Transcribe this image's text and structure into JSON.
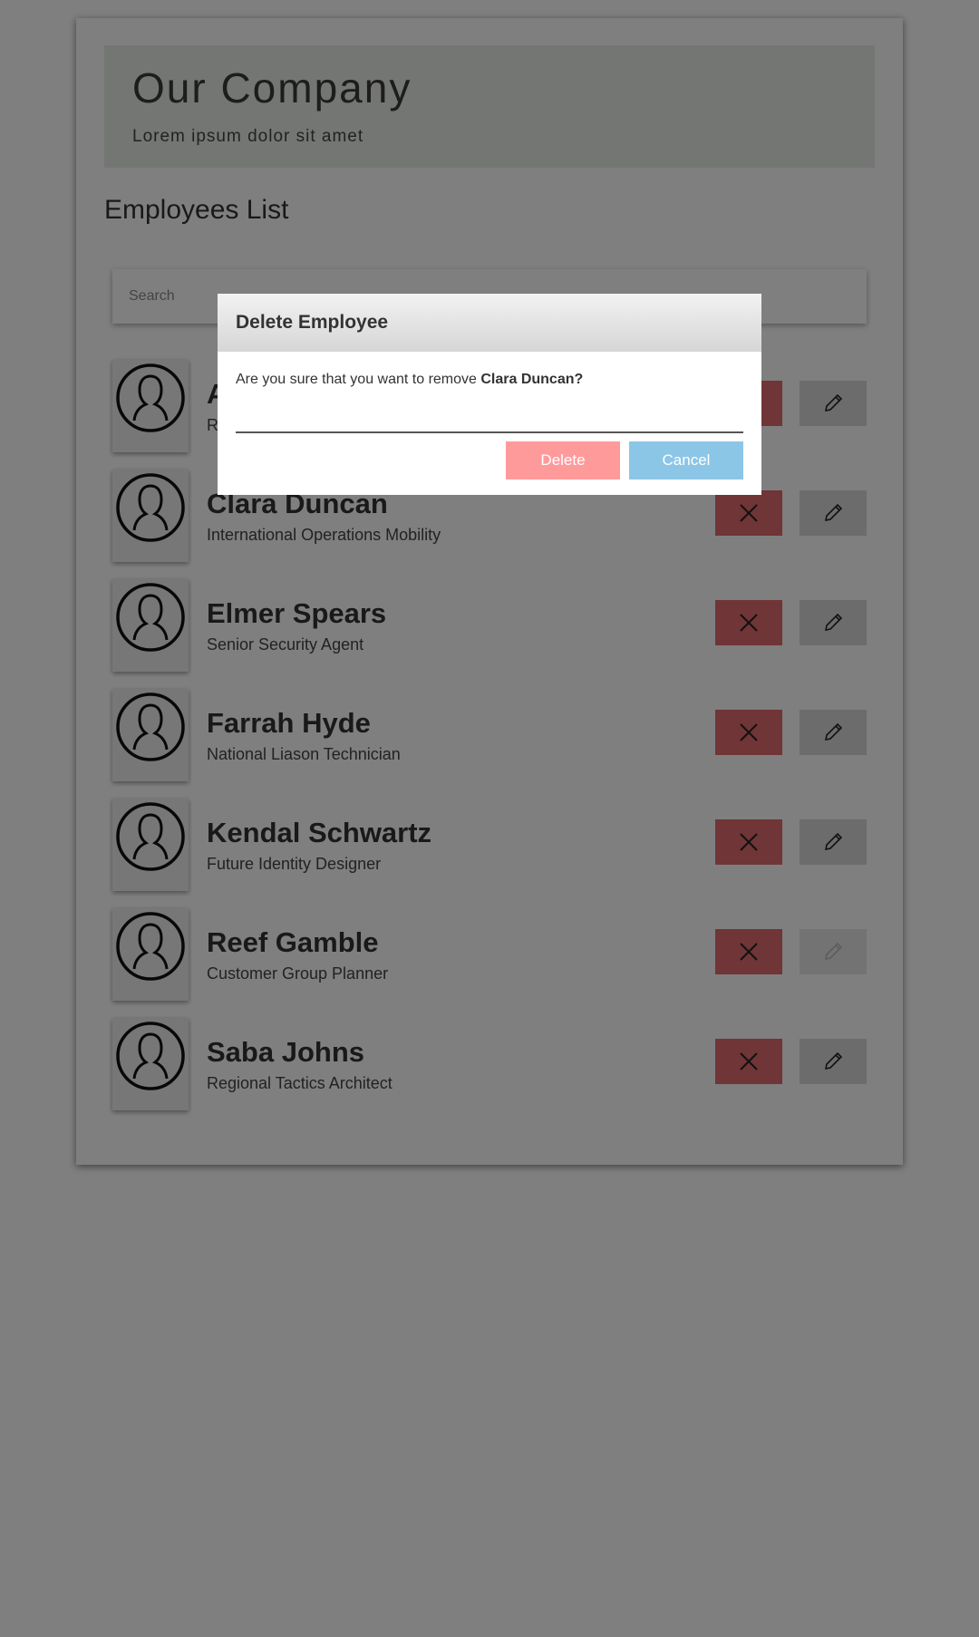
{
  "banner": {
    "title": "Our Company",
    "subtitle": "Lorem ipsum dolor sit amet"
  },
  "list": {
    "title": "Employees List",
    "search_placeholder": "Search"
  },
  "employees": [
    {
      "name": "A",
      "title": "R"
    },
    {
      "name": "Clara Duncan",
      "title": "International Operations Mobility"
    },
    {
      "name": "Elmer Spears",
      "title": "Senior Security Agent"
    },
    {
      "name": "Farrah Hyde",
      "title": "National Liason Technician"
    },
    {
      "name": "Kendal Schwartz",
      "title": "Future Identity Designer"
    },
    {
      "name": "Reef Gamble",
      "title": "Customer Group Planner"
    },
    {
      "name": "Saba Johns",
      "title": "Regional Tactics Architect"
    }
  ],
  "modal": {
    "title": "Delete Employee",
    "message": "Are you sure that you want to remove ",
    "target": "Clara Duncan?",
    "delete_label": "Delete",
    "cancel_label": "Cancel"
  },
  "icons": {
    "avatar": "user-silhouette-icon",
    "delete": "close-x-icon",
    "edit": "pencil-icon"
  },
  "colors": {
    "delete_button": "#e06a6e",
    "edit_button": "#d8d8d8",
    "modal_delete": "#ff9a9b",
    "modal_cancel": "#8cc6e6",
    "banner": "#e8ece6"
  }
}
